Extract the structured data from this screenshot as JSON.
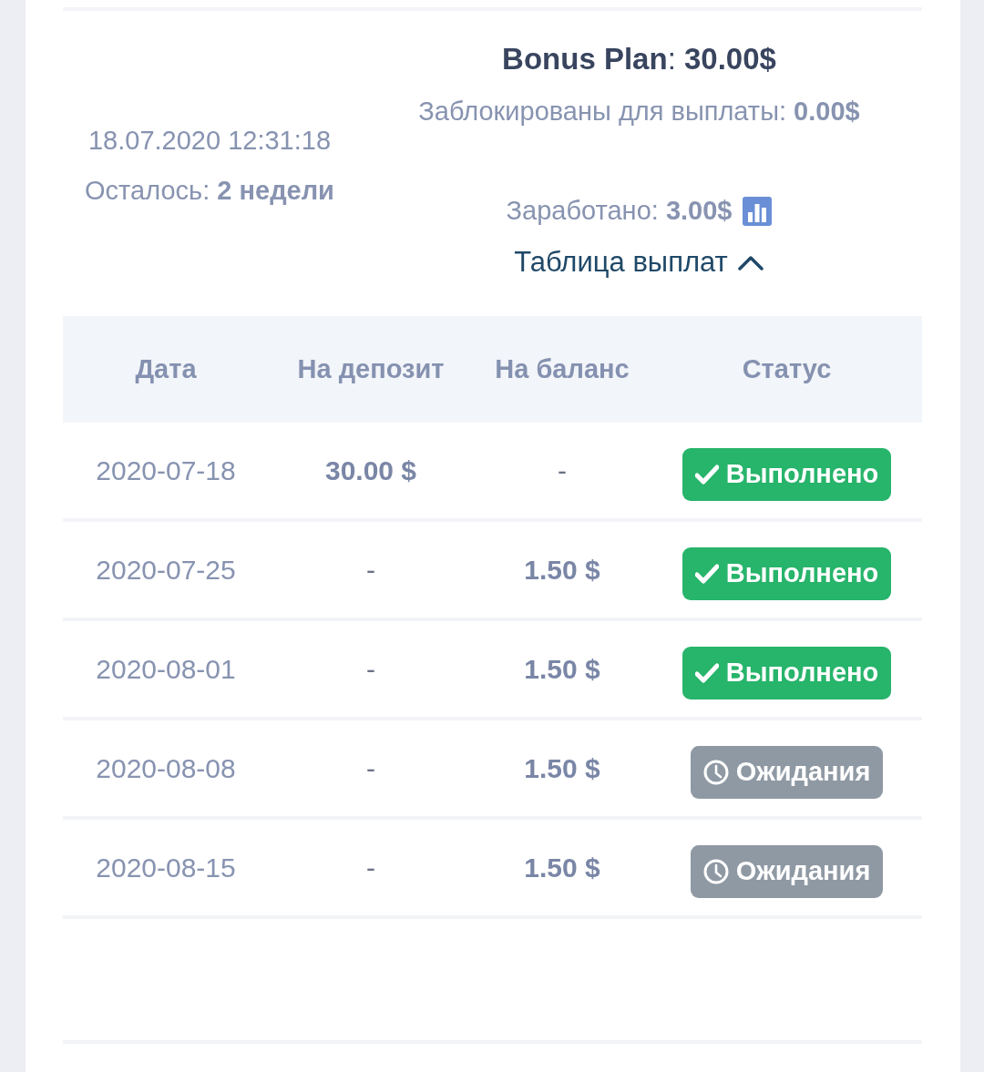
{
  "summary": {
    "date": "18.07.2020 12:31:18",
    "remaining": "Осталось: **2 недели**",
    "plan": "**Bonus Plan**: **30.00$**",
    "blocked": "Заблокированы для выплаты: **0.00$**",
    "earned": "Заработано: **3.00$**"
  },
  "toggle": {
    "label": "Таблица выплат",
    "expanded": true
  },
  "table": {
    "columns": [
      "Дата",
      "На депозит",
      "На баланс",
      "Статус"
    ],
    "rows": [
      {
        "date": "2020-07-18",
        "deposit": "30.00 $",
        "balance": "-",
        "status": {
          "kind": "done",
          "label": "Выполнено"
        }
      },
      {
        "date": "2020-07-25",
        "deposit": "-",
        "balance": "1.50 $",
        "status": {
          "kind": "done",
          "label": "Выполнено"
        }
      },
      {
        "date": "2020-08-01",
        "deposit": "-",
        "balance": "1.50 $",
        "status": {
          "kind": "done",
          "label": "Выполнено"
        }
      },
      {
        "date": "2020-08-08",
        "deposit": "-",
        "balance": "1.50 $",
        "status": {
          "kind": "pending",
          "label": "Ожидания"
        }
      },
      {
        "date": "2020-08-15",
        "deposit": "-",
        "balance": "1.50 $",
        "status": {
          "kind": "pending",
          "label": "Ожидания"
        }
      }
    ]
  }
}
